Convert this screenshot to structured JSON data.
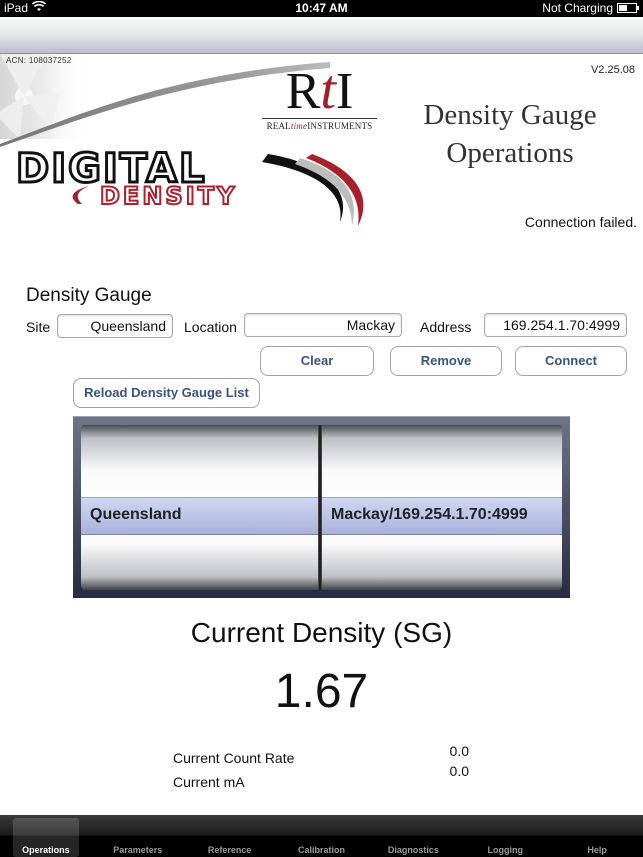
{
  "status_bar": {
    "device": "iPad",
    "time": "10:47 AM",
    "charging_status": "Not Charging",
    "battery_level": 0.5
  },
  "header": {
    "acn": "ACN: 108037252",
    "version": "V2.25.08",
    "title_line1": "Density Gauge",
    "title_line2": "Operations",
    "connection_status": "Connection failed.",
    "logos": {
      "rti_mark_r": "R",
      "rti_mark_t": "t",
      "rti_mark_i": "I",
      "rti_sub_pre": "REAL",
      "rti_sub_mid": "time",
      "rti_sub_post": "INSTRUMENTS",
      "product_line1": "DIGITAL",
      "product_line2": "DENSITY"
    }
  },
  "gauge_form": {
    "section_title": "Density Gauge",
    "site_label": "Site",
    "site_value": "Queensland",
    "location_label": "Location",
    "location_value": "Mackay",
    "address_label": "Address",
    "address_value": "169.254.1.70:4999",
    "buttons": {
      "clear": "Clear",
      "remove": "Remove",
      "connect": "Connect",
      "reload": "Reload Density Gauge List"
    }
  },
  "picker": {
    "columns": [
      {
        "selected": "Queensland"
      },
      {
        "selected": "Mackay/169.254.1.70:4999"
      }
    ]
  },
  "readings": {
    "density_title": "Current Density (SG)",
    "density_value": "1.67",
    "count_rate_label": "Current Count Rate",
    "count_rate_value": "0.0",
    "ma_label": "Current mA",
    "ma_value": "0.0"
  },
  "tabbar": {
    "tabs": [
      {
        "label": "Operations",
        "active": true
      },
      {
        "label": "Parameters"
      },
      {
        "label": "Reference"
      },
      {
        "label": "Calibration"
      },
      {
        "label": "Diagnostics"
      },
      {
        "label": "Logging"
      },
      {
        "label": "Help"
      }
    ]
  }
}
